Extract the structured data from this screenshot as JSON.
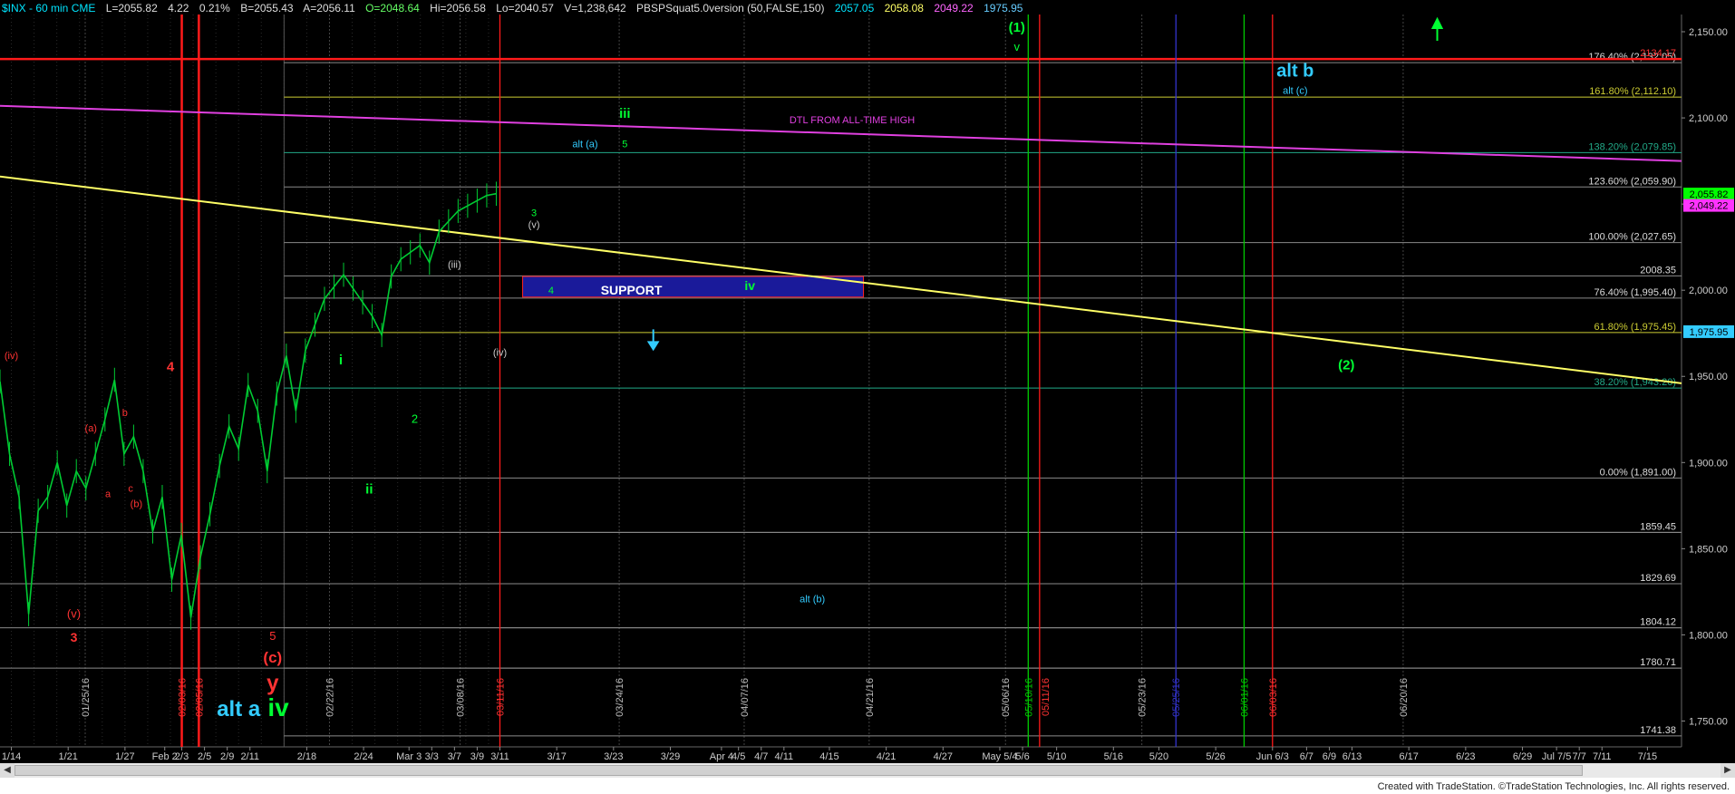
{
  "header": {
    "symbol": "$INX - 60 min  CME",
    "last": "L=2055.82",
    "change": "4.22",
    "pct": "0.21%",
    "bid": "B=2055.43",
    "ask": "A=2056.11",
    "open": "O=2048.64",
    "high": "Hi=2056.58",
    "low": "Lo=2040.57",
    "volume": "V=1,238,642",
    "study": "PBSPSquat5.0version (50,FALSE,150)",
    "study_values": [
      {
        "text": "2057.05",
        "color": "#00e5ff"
      },
      {
        "text": "2058.08",
        "color": "#ffff66"
      },
      {
        "text": "2049.22",
        "color": "#ff66ff"
      },
      {
        "text": "1975.95",
        "color": "#66ccff"
      }
    ]
  },
  "footer": "Created with TradeStation. ©TradeStation Technologies, Inc. All rights reserved.",
  "colors": {
    "background": "#000000",
    "price_bars": "#00cc33",
    "fib_lines": "#8a8a8a",
    "red_lines": "#ff1a1a",
    "magenta_trendline": "#e040e0",
    "yellow_trendline": "#ffff66",
    "support_box": "#1a1a9a",
    "green_lines": "#00cc00",
    "blue_lines": "#3333cc",
    "cyan_labels": "#33ccff"
  },
  "chart_data": {
    "type": "line",
    "title": "",
    "xlabel": "",
    "ylabel": "",
    "ylim": [
      1735,
      2160
    ],
    "y_ticks": [
      "2,150.00",
      "2,100.00",
      "2,050.00",
      "2,000.00",
      "1,950.00",
      "1,900.00",
      "1,850.00",
      "1,800.00",
      "1,750.00"
    ],
    "y_tick_values": [
      2150,
      2100,
      2050,
      2000,
      1950,
      1900,
      1850,
      1800,
      1750
    ],
    "x_ticks": [
      "1/14",
      "1/21",
      "1/27",
      "Feb 2",
      "2/3",
      "2/5",
      "2/9",
      "2/11",
      "2/18",
      "2/24",
      "Mar 3",
      "3/3",
      "3/7",
      "3/9",
      "3/11",
      "3/17",
      "3/23",
      "3/29",
      "Apr 4",
      "4/5",
      "4/7",
      "4/11",
      "4/15",
      "4/21",
      "4/27",
      "May 5/4",
      "5/6",
      "5/10",
      "5/16",
      "5/20",
      "5/26",
      "Jun 6/3",
      "6/7",
      "6/9",
      "6/13",
      "6/17",
      "6/23",
      "6/29",
      "Jul 7/5",
      "7/7",
      "7/11",
      "7/15"
    ],
    "x_tick_index": [
      1,
      6,
      11,
      14.5,
      16,
      18,
      20,
      22,
      27,
      32,
      36,
      38,
      40,
      42,
      44,
      49,
      54,
      59,
      63.5,
      65,
      67,
      69,
      73,
      78,
      83,
      88,
      90,
      93,
      98,
      102,
      107,
      112,
      115,
      117,
      119,
      124,
      129,
      134,
      137,
      139,
      141,
      145
    ],
    "price_series": {
      "name": "$INX",
      "index": [
        0,
        1,
        2,
        3,
        4,
        5,
        6,
        7,
        8,
        9,
        10,
        11,
        12,
        13,
        14,
        15,
        16,
        17,
        18,
        19,
        20,
        21,
        22,
        23,
        24,
        25,
        26,
        27,
        28,
        29,
        30,
        31,
        32,
        33,
        34,
        35,
        36,
        37,
        38,
        39,
        40,
        41,
        42,
        43,
        44,
        45,
        46,
        47,
        48,
        49,
        50,
        51,
        52
      ],
      "values": [
        1947,
        1905,
        1880,
        1812,
        1872,
        1880,
        1900,
        1875,
        1895,
        1885,
        1905,
        1925,
        1948,
        1905,
        1915,
        1895,
        1860,
        1880,
        1832,
        1858,
        1810,
        1845,
        1870,
        1898,
        1921,
        1908,
        1945,
        1930,
        1895,
        1940,
        1962,
        1930,
        1965,
        1980,
        1995,
        2002,
        2009,
        2001,
        1993,
        1985,
        1974,
        2008,
        2018,
        2022,
        2026,
        2016,
        2034,
        2040,
        2046,
        2049,
        2052,
        2055,
        2056
      ]
    },
    "price_labels": [
      {
        "text": "2,055.82",
        "value": 2055.82,
        "bg": "#00ff00",
        "fg": "#000000"
      },
      {
        "text": "2,049.22",
        "value": 2049.22,
        "bg": "#ff33ff",
        "fg": "#000000"
      },
      {
        "text": "1,975.95",
        "value": 1975.95,
        "bg": "#33ccff",
        "fg": "#000000"
      }
    ],
    "fib_levels": [
      {
        "text": "176.40% (2,132.05)",
        "value": 2132.05,
        "color": "#dddddd"
      },
      {
        "text": "161.80% (2,112.10)",
        "value": 2112.1,
        "color": "#cccc33"
      },
      {
        "text": "138.20% (2,079.85)",
        "value": 2079.85,
        "color": "#22aa88"
      },
      {
        "text": "123.60% (2,059.90)",
        "value": 2059.9,
        "color": "#dddddd"
      },
      {
        "text": "100.00% (2,027.65)",
        "value": 2027.65,
        "color": "#dddddd"
      },
      {
        "text": "2008.35",
        "value": 2008.35,
        "color": "#dddddd"
      },
      {
        "text": "76.40% (1,995.40)",
        "value": 1995.4,
        "color": "#dddddd"
      },
      {
        "text": "61.80% (1,975.45)",
        "value": 1975.45,
        "color": "#cccc33"
      },
      {
        "text": "38.20% (1,943.20)",
        "value": 1943.2,
        "color": "#22aa88"
      },
      {
        "text": "0.00% (1,891.00)",
        "value": 1891.0,
        "color": "#dddddd"
      },
      {
        "text": "1859.45",
        "value": 1859.45,
        "color": "#dddddd"
      },
      {
        "text": "1829.69",
        "value": 1829.69,
        "color": "#dddddd"
      },
      {
        "text": "1804.12",
        "value": 1804.12,
        "color": "#dddddd"
      },
      {
        "text": "1780.71",
        "value": 1780.71,
        "color": "#dddddd"
      },
      {
        "text": "1741.38",
        "value": 1741.38,
        "color": "#dddddd"
      }
    ],
    "red_level": {
      "text": "2134.17",
      "value": 2134.17
    },
    "trendlines": [
      {
        "name": "DTL FROM ALL-TIME HIGH",
        "color": "#e040e0",
        "from": [
          0,
          2107
        ],
        "to": [
          148,
          2075
        ]
      },
      {
        "name": "yellow",
        "color": "#ffff66",
        "from": [
          0,
          2066
        ],
        "to": [
          148,
          1946
        ]
      }
    ],
    "support": {
      "text": "SUPPORT",
      "from": [
        46,
        2008
      ],
      "to": [
        76,
        1996
      ]
    },
    "vertical_lines": [
      {
        "index": 16,
        "color": "#ff1a1a",
        "label": "02/03/16"
      },
      {
        "index": 17.5,
        "color": "#ff1a1a",
        "label": "02/05/16"
      },
      {
        "index": 44,
        "color": "#ff1a1a",
        "label": "03/11/16"
      },
      {
        "index": 90.5,
        "color": "#00cc00",
        "label": "05/10/16"
      },
      {
        "index": 91.5,
        "color": "#ff1a1a",
        "label": "05/11/16"
      },
      {
        "index": 103.5,
        "color": "#3333cc",
        "label": "05/25/16"
      },
      {
        "index": 109.5,
        "color": "#00cc00",
        "label": "06/01/16"
      },
      {
        "index": 112,
        "color": "#ff1a1a",
        "label": "06/03/16"
      }
    ],
    "date_labels": [
      {
        "index": 7.5,
        "text": "01/25/16",
        "color": "#bbbbbb"
      },
      {
        "index": 16,
        "text": "02/03/16",
        "color": "#ff3333"
      },
      {
        "index": 17.5,
        "text": "02/05/16",
        "color": "#ff3333"
      },
      {
        "index": 29,
        "text": "02/22/16",
        "color": "#bbbbbb"
      },
      {
        "index": 40.5,
        "text": "03/08/16",
        "color": "#bbbbbb"
      },
      {
        "index": 44,
        "text": "03/11/16",
        "color": "#ff3333"
      },
      {
        "index": 54.5,
        "text": "03/24/16",
        "color": "#bbbbbb"
      },
      {
        "index": 65.5,
        "text": "04/07/16",
        "color": "#bbbbbb"
      },
      {
        "index": 76.5,
        "text": "04/21/16",
        "color": "#bbbbbb"
      },
      {
        "index": 88.5,
        "text": "05/06/16",
        "color": "#bbbbbb"
      },
      {
        "index": 90.5,
        "text": "05/10/16",
        "color": "#00cc00"
      },
      {
        "index": 92,
        "text": "05/11/16",
        "color": "#ff3333"
      },
      {
        "index": 100.5,
        "text": "05/23/16",
        "color": "#bbbbbb"
      },
      {
        "index": 103.5,
        "text": "05/25/16",
        "color": "#3333cc"
      },
      {
        "index": 109.5,
        "text": "06/01/16",
        "color": "#00cc00"
      },
      {
        "index": 112,
        "text": "06/03/16",
        "color": "#ff3333"
      },
      {
        "index": 123.5,
        "text": "06/20/16",
        "color": "#bbbbbb"
      }
    ],
    "wave_labels": [
      {
        "text": "(iv)",
        "index": 1,
        "value": 1960,
        "color": "#ff3333",
        "size": 11
      },
      {
        "text": "(a)",
        "index": 8,
        "value": 1918,
        "color": "#ff3333",
        "size": 11
      },
      {
        "text": "b",
        "index": 11,
        "value": 1927,
        "color": "#ff3333",
        "size": 11
      },
      {
        "text": "4",
        "index": 15,
        "value": 1953,
        "color": "#ff3333",
        "size": 15
      },
      {
        "text": "a",
        "index": 9.5,
        "value": 1880,
        "color": "#ff3333",
        "size": 11
      },
      {
        "text": "c",
        "index": 11.5,
        "value": 1883,
        "color": "#ff3333",
        "size": 11
      },
      {
        "text": "(b)",
        "index": 12,
        "value": 1874,
        "color": "#ff3333",
        "size": 11
      },
      {
        "text": "(v)",
        "index": 6.5,
        "value": 1810,
        "color": "#ff3333",
        "size": 13
      },
      {
        "text": "3",
        "index": 6.5,
        "value": 1796,
        "color": "#ff3333",
        "size": 14
      },
      {
        "text": "5",
        "index": 24,
        "value": 1797,
        "color": "#ff3333",
        "size": 13
      },
      {
        "text": "(c)",
        "index": 24,
        "value": 1784,
        "color": "#ff3333",
        "size": 17
      },
      {
        "text": "y",
        "index": 24,
        "value": 1768,
        "color": "#ff3333",
        "size": 24
      },
      {
        "text": "alt a",
        "index": 21,
        "value": 1753,
        "color": "#33ccff",
        "size": 24
      },
      {
        "text": "iv",
        "index": 24.5,
        "value": 1753,
        "color": "#00ff33",
        "size": 28
      },
      {
        "text": "i",
        "index": 30,
        "value": 1957,
        "color": "#00ff33",
        "size": 15
      },
      {
        "text": "ii",
        "index": 32.5,
        "value": 1882,
        "color": "#00ff33",
        "size": 15
      },
      {
        "text": "2",
        "index": 36.5,
        "value": 1923,
        "color": "#00ff33",
        "size": 13
      },
      {
        "text": "(iii)",
        "index": 40,
        "value": 2013,
        "color": "#cccccc",
        "size": 11
      },
      {
        "text": "(iv)",
        "index": 44,
        "value": 1962,
        "color": "#cccccc",
        "size": 11
      },
      {
        "text": "(v)",
        "index": 47,
        "value": 2036,
        "color": "#cccccc",
        "size": 11
      },
      {
        "text": "3",
        "index": 47,
        "value": 2043,
        "color": "#00ff33",
        "size": 11
      },
      {
        "text": "4",
        "index": 48.5,
        "value": 1998,
        "color": "#00ff33",
        "size": 11
      },
      {
        "text": "iii",
        "index": 55,
        "value": 2100,
        "color": "#00ff33",
        "size": 15
      },
      {
        "text": "alt (a)",
        "index": 51.5,
        "value": 2083,
        "color": "#33ccff",
        "size": 11
      },
      {
        "text": "5",
        "index": 55,
        "value": 2083,
        "color": "#00ff33",
        "size": 11
      },
      {
        "text": "iv",
        "index": 66,
        "value": 2000,
        "color": "#00ff33",
        "size": 14
      },
      {
        "text": "DTL FROM ALL-TIME HIGH",
        "index": 75,
        "value": 2097,
        "color": "#e040e0",
        "size": 11
      },
      {
        "text": "(1)",
        "index": 89.5,
        "value": 2150,
        "color": "#00ff33",
        "size": 15
      },
      {
        "text": "v",
        "index": 89.5,
        "value": 2139,
        "color": "#00ff33",
        "size": 13
      },
      {
        "text": "alt b",
        "index": 114,
        "value": 2124,
        "color": "#33ccff",
        "size": 20
      },
      {
        "text": "alt (c)",
        "index": 114,
        "value": 2114,
        "color": "#33ccff",
        "size": 11
      },
      {
        "text": "(2)",
        "index": 118.5,
        "value": 1954,
        "color": "#00ff33",
        "size": 15
      },
      {
        "text": "alt (b)",
        "index": 71.5,
        "value": 1819,
        "color": "#33ccff",
        "size": 11
      }
    ],
    "arrows": [
      {
        "direction": "up",
        "index": 126.5,
        "value": 2150,
        "color": "#00ff33"
      },
      {
        "direction": "down",
        "index": 57.5,
        "value": 1972,
        "color": "#33ccff"
      }
    ]
  }
}
